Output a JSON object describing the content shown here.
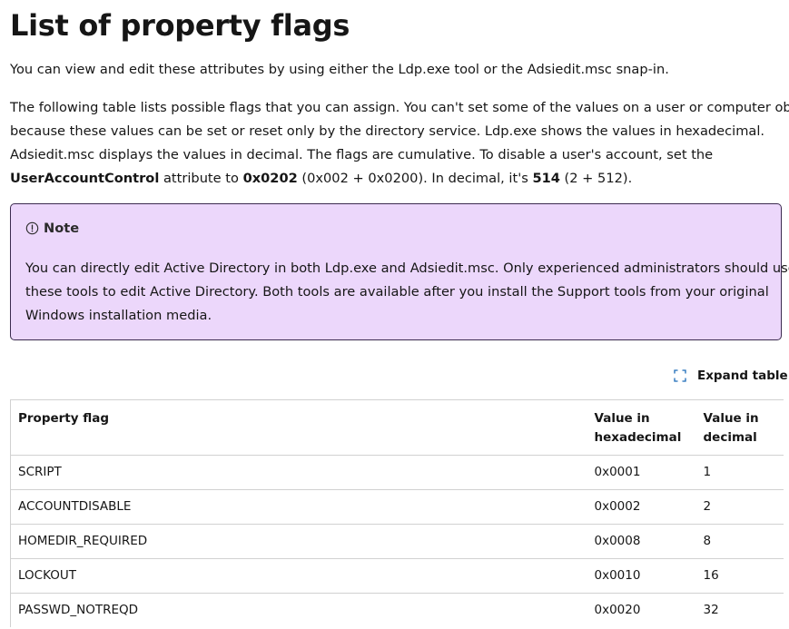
{
  "heading": "List of property flags",
  "intro": "You can view and edit these attributes by using either the Ldp.exe tool or the Adsiedit.msc snap-in.",
  "description": {
    "line1": "The following table lists possible flags that you can assign. You can't set some of the values on a user or computer object",
    "line2": "because these values can be set or reset only by the directory service. Ldp.exe shows the values in hexadecimal.",
    "line3": "Adsiedit.msc displays the values in decimal. The flags are cumulative. To disable a user's account, set the",
    "attr_name": "UserAccountControl",
    "text_a": " attribute to ",
    "hex_value": "0x0202",
    "text_b": " (0x002 + 0x0200). In decimal, it's ",
    "dec_value": "514",
    "text_c": " (2 + 512)."
  },
  "note": {
    "title": "Note",
    "icon": "info-circle-icon",
    "line1": "You can directly edit Active Directory in both Ldp.exe and Adsiedit.msc. Only experienced administrators should use",
    "line2": "these tools to edit Active Directory. Both tools are available after you install the Support tools from your original",
    "line3": "Windows installation media.",
    "background": "#ecd7fb",
    "border": "#3b2a4f"
  },
  "expand_label": "Expand table",
  "table": {
    "headers": {
      "flag": "Property flag",
      "hex_line1": "Value in",
      "hex_line2": "hexadecimal",
      "dec_line1": "Value in",
      "dec_line2": "decimal"
    },
    "rows": [
      {
        "flag": "SCRIPT",
        "hex": "0x0001",
        "dec": "1"
      },
      {
        "flag": "ACCOUNTDISABLE",
        "hex": "0x0002",
        "dec": "2"
      },
      {
        "flag": "HOMEDIR_REQUIRED",
        "hex": "0x0008",
        "dec": "8"
      },
      {
        "flag": "LOCKOUT",
        "hex": "0x0010",
        "dec": "16"
      },
      {
        "flag": "PASSWD_NOTREQD",
        "hex": "0x0020",
        "dec": "32"
      }
    ]
  }
}
